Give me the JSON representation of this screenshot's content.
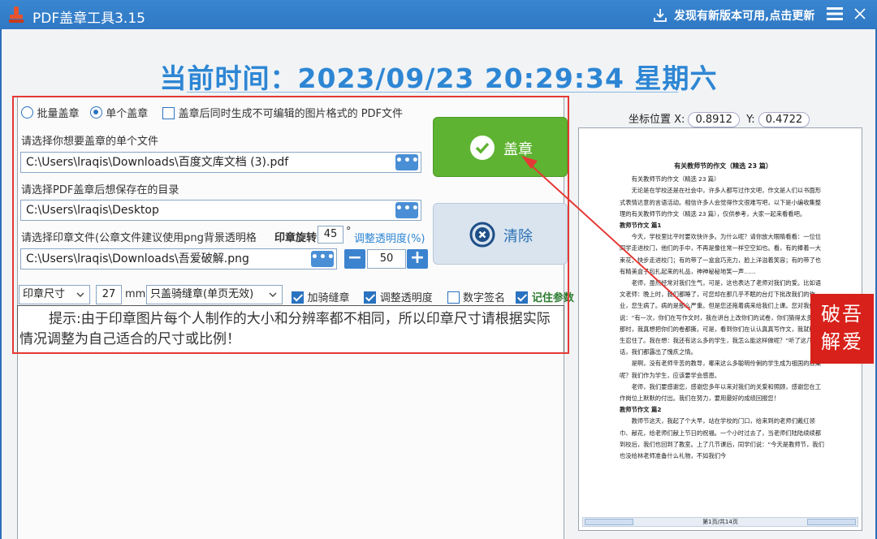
{
  "titlebar": {
    "title": "PDF盖章工具3.15",
    "update_text": "发现有新版本可用,点击更新",
    "icons": [
      "stamp-app-icon",
      "download-icon",
      "menu-icon",
      "close-icon"
    ]
  },
  "clock": {
    "text": "当前时间：2023/09/23 20:29:34  星期六"
  },
  "mode": {
    "batch_label": "批量盖章",
    "single_label": "单个盖章",
    "selected": "single",
    "image_pdf_label": "盖章后同时生成不可编辑的图片格式的 PDF文件",
    "image_pdf_checked": false
  },
  "file": {
    "prompt": "请选择你想要盖章的单个文件",
    "value": "C:\\Users\\lraqis\\Downloads\\百度文库文档 (3).pdf",
    "browse_label": "•••"
  },
  "save_dir": {
    "prompt": "请选择PDF盖章后想保存在的目录",
    "value": "C:\\Users\\lraqis\\Desktop",
    "browse_label": "•••"
  },
  "seal_file": {
    "prompt": "请选择印章文件(公章文件建议使用png背景透明格",
    "value": "C:\\Users\\lraqis\\Downloads\\吾爱破解.png",
    "browse_label": "•••"
  },
  "rotation": {
    "label": "印章旋转",
    "value": "45",
    "unit": "°",
    "link": "调整透明度(%)"
  },
  "opacity": {
    "minus": "−",
    "value": "50",
    "plus": "+"
  },
  "buttons": {
    "stamp": "盖章",
    "clear": "清除"
  },
  "options": {
    "size_select": "印章尺寸",
    "size_value": "27",
    "size_unit": "mm",
    "mode_select": "只盖骑缝章(单页无效)",
    "checks": [
      {
        "label": "加骑缝章",
        "checked": true
      },
      {
        "label": "调整透明度",
        "checked": true
      },
      {
        "label": "数字签名",
        "checked": false
      },
      {
        "label": "记住参数",
        "checked": true
      }
    ]
  },
  "tip": "提示:由于印章图片每个人制作的大小和分辨率都不相同，所以印章尺寸请根据实际情况调整为自己适合的尺寸或比例！",
  "coords": {
    "label": "坐标位置",
    "x_label": "X:",
    "x": "0.8912",
    "y_label": "Y:",
    "y": "0.4722"
  },
  "preview": {
    "title": "有关教师节的作文（精选 23 篇）",
    "lines": [
      {
        "t": "有关教师节的作文（精选 23 篇）",
        "h": false
      },
      {
        "t": "无论是在学校还是在社会中，许多人都写过作文吧，作文是人们以书面形式表情达意的言语活动。相信许多人会觉得作文很难写吧，以下是小编收集整理的有关教师节的作文（精选 23 篇），仅供参考，大家一起来看看吧。",
        "h": false
      },
      {
        "t": "教师节作文 篇1",
        "h": true
      },
      {
        "t": "今天，学校里比平时要欢快许多。为什么呢？请你放大眼睛看看：一位位同学走进校门，他们的手中，不再是像往常一样空空如也。看，有的捧着一大束花，快步走进校门；有的带了一盒盒巧克力，脸上洋溢着笑容；有的带了也有精美盒子包扎起来的礼品，神神秘秘地笑一声……",
        "h": false
      },
      {
        "t": "老师，虽然经常对我们生气，可是，这也表达了老师对我们的爱。比如语文老师：晚上时，我们都睡了，可您却在那几乎不眠的台灯下批改我们的作业，您生病了。病的是那么严重。但是您还拖着病来给我们上课。您对我们说：“有一次，你们在写作文时，我在讲台上改你们的试卷，你们猜得太多了。那时，我真想把你们的卷都撕。可是，看到你们在认认真真写作文，我就硬生生忍住了。我在想：我还有这么多的学生，我怎么能这样做呢？”听了这几句话，我们都露出了愧疚之情。",
        "h": false
      },
      {
        "t": "是啊，没有老师辛苦的教导，哪来这么多聪明伶俐的学生成为祖国的栋梁呢？我们作为学生，应该要学会感恩。",
        "h": false
      },
      {
        "t": "老师，我们要感谢您，感谢您多年以来对我们的关爱和照顾，感谢您在工作岗位上默默的付出。我们在努力，要用最好的成绩回报您！",
        "h": false
      },
      {
        "t": "教师节作文 篇2",
        "h": true
      },
      {
        "t": "教师节这天，我起了个大早，站在学校的门口，给来到的老师们戴红领巾、献花，给老师们献上节日的祝福。一个小时过去了，当老师们陆陆续续都到校后，我们也回到了教室。上了几节课后，同学们说：“今天是教师节，我们也没给林老师准备什么礼物，不如我们今",
        "h": false
      }
    ],
    "pager": "第1页/共14页"
  },
  "seal_text": "破吾解爱",
  "colors": {
    "title_bar": "#2f78c4",
    "accent": "#2d86d4",
    "stamp_button": "#5fb332",
    "highlight": "#e53935",
    "seal": "#d8211a"
  }
}
